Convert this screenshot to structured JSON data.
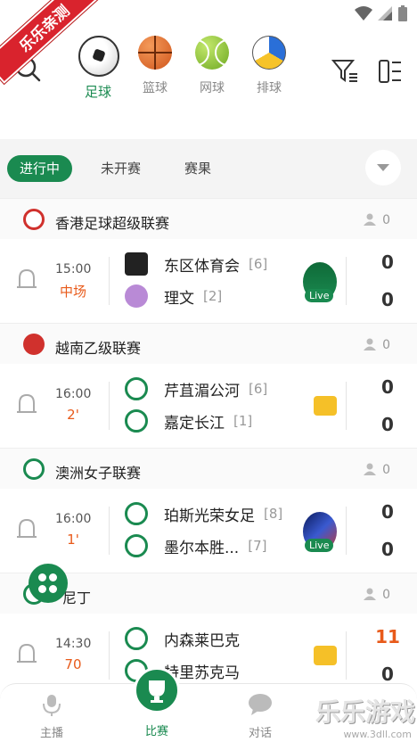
{
  "banner": "乐乐亲测",
  "sports": [
    {
      "label": "足球",
      "icon": "soccer-ball-icon",
      "color": "#ffffff",
      "active": true
    },
    {
      "label": "篮球",
      "icon": "basketball-icon",
      "color": "#e1672b",
      "active": false
    },
    {
      "label": "网球",
      "icon": "tennis-ball-icon",
      "color": "#8ac43f",
      "active": false
    },
    {
      "label": "排球",
      "icon": "volleyball-icon",
      "color": "#2a6fd8",
      "active": false
    }
  ],
  "tabs": {
    "live": "进行中",
    "upcoming": "未开赛",
    "results": "赛果"
  },
  "leagues": [
    {
      "name": "香港足球超级联赛",
      "count": "0",
      "icon": "hk-league-logo",
      "color": "#d0312d",
      "match": {
        "time": "15:00",
        "status": "中场",
        "home": {
          "name": "东区体育会",
          "rank": "[6]"
        },
        "away": {
          "name": "理文",
          "rank": "[2]"
        },
        "home_score": "0",
        "away_score": "0",
        "media": "live",
        "live_label": "Live"
      }
    },
    {
      "name": "越南乙级联赛",
      "count": "0",
      "icon": "vpf-logo",
      "color": "#d0312d",
      "match": {
        "time": "16:00",
        "status": "2'",
        "home": {
          "name": "芹苴湄公河",
          "rank": "[6]"
        },
        "away": {
          "name": "嘉定长江",
          "rank": "[1]"
        },
        "home_score": "0",
        "away_score": "0",
        "media": "animation"
      }
    },
    {
      "name": "澳洲女子联赛",
      "count": "0",
      "icon": "shield-logo",
      "color": "#1a8a50",
      "match": {
        "time": "16:00",
        "status": "1'",
        "home": {
          "name": "珀斯光荣女足",
          "rank": "[8]"
        },
        "away": {
          "name": "墨尔本胜...",
          "rank": "[7]"
        },
        "home_score": "0",
        "away_score": "0",
        "media": "live",
        "live_label": "Live"
      }
    },
    {
      "name": "尼丁",
      "count": "0",
      "icon": "shield-logo",
      "color": "#1a8a50",
      "match": {
        "time": "14:30",
        "status": "70",
        "home": {
          "name": "内森莱巴克",
          "rank": ""
        },
        "away": {
          "name": "特里苏克马",
          "rank": ""
        },
        "home_score": "11",
        "away_score": "0",
        "media": "animation",
        "home_highlight": true
      }
    }
  ],
  "bottom_nav": {
    "broadcast": "主播",
    "matches": "比赛",
    "chat": "对话"
  },
  "watermark": {
    "title": "乐乐游戏",
    "url": "www.3dll.com"
  },
  "colors": {
    "accent": "#1a8a50",
    "live_status": "#e85a1a"
  }
}
